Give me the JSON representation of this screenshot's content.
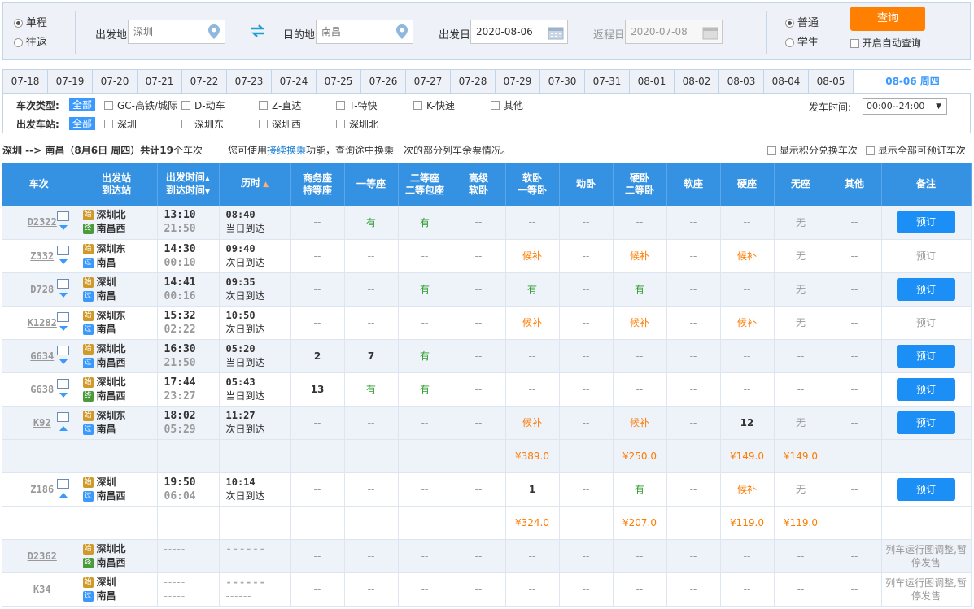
{
  "search": {
    "trip_types": [
      {
        "label": "单程",
        "checked": true
      },
      {
        "label": "往返",
        "checked": false
      }
    ],
    "from_label": "出发地",
    "from_value": "深圳",
    "to_label": "目的地",
    "to_value": "南昌",
    "date_label": "出发日",
    "date_value": "2020-08-06",
    "return_label": "返程日",
    "return_value": "2020-07-08",
    "pass_types": [
      {
        "label": "普通",
        "checked": true
      },
      {
        "label": "学生",
        "checked": false
      }
    ],
    "query_label": "查询",
    "auto_label": "开启自动查询"
  },
  "date_tabs": [
    "07-18",
    "07-19",
    "07-20",
    "07-21",
    "07-22",
    "07-23",
    "07-24",
    "07-25",
    "07-26",
    "07-27",
    "07-28",
    "07-29",
    "07-30",
    "07-31",
    "08-01",
    "08-02",
    "08-03",
    "08-04",
    "08-05"
  ],
  "current_tab": "08-06 周四",
  "filter": {
    "type_title": "车次类型:",
    "all": "全部",
    "types": [
      "GC-高铁/城际",
      "D-动车",
      "Z-直达",
      "T-特快",
      "K-快速",
      "其他"
    ],
    "station_title": "出发车站:",
    "stations": [
      "深圳",
      "深圳东",
      "深圳西",
      "深圳北"
    ],
    "time_title": "发车时间:",
    "time_value": "00:00--24:00"
  },
  "info": {
    "route": "深圳 --> 南昌（8月6日  周四）共计",
    "count": "19",
    "count_suffix": "个车次",
    "tip_prefix": "您可使用",
    "tip_link": "接续换乘",
    "tip_suffix": "功能，查询途中换乘一次的部分列车余票情况。",
    "opt1": "显示积分兑换车次",
    "opt2": "显示全部可预订车次"
  },
  "columns": [
    [
      "车次"
    ],
    [
      "出发站",
      "到达站"
    ],
    [
      "出发时间",
      "到达时间"
    ],
    [
      "历时"
    ],
    [
      "商务座",
      "特等座"
    ],
    [
      "一等座"
    ],
    [
      "二等座",
      "二等包座"
    ],
    [
      "高级",
      "软卧"
    ],
    [
      "软卧",
      "一等卧"
    ],
    [
      "动卧"
    ],
    [
      "硬卧",
      "二等卧"
    ],
    [
      "软座"
    ],
    [
      "硬座"
    ],
    [
      "无座"
    ],
    [
      "其他"
    ],
    [
      "备注"
    ]
  ],
  "rows": [
    {
      "code": "D2322",
      "arrow": "down",
      "from": "深圳北",
      "fromType": "始",
      "to": "南昌西",
      "toType": "终",
      "dep": "13:10",
      "arr": "21:50",
      "dur": "08:40",
      "day": "当日到达",
      "seats": [
        "--",
        "有",
        "有",
        "--",
        "--",
        "--",
        "--",
        "--",
        "--",
        "无",
        "--"
      ],
      "note": "预订",
      "bookable": true,
      "alt": true
    },
    {
      "code": "Z332",
      "arrow": "down",
      "from": "深圳东",
      "fromType": "始",
      "to": "南昌",
      "toType": "过",
      "dep": "14:30",
      "arr": "00:10",
      "dur": "09:40",
      "day": "次日到达",
      "seats": [
        "--",
        "--",
        "--",
        "--",
        "候补",
        "--",
        "候补",
        "--",
        "候补",
        "无",
        "--"
      ],
      "note": "预订",
      "bookable": false,
      "alt": false
    },
    {
      "code": "D728",
      "arrow": "down",
      "from": "深圳",
      "fromType": "始",
      "to": "南昌",
      "toType": "过",
      "dep": "14:41",
      "arr": "00:16",
      "dur": "09:35",
      "day": "次日到达",
      "seats": [
        "--",
        "--",
        "有",
        "--",
        "有",
        "--",
        "有",
        "--",
        "--",
        "无",
        "--"
      ],
      "note": "预订",
      "bookable": true,
      "alt": true
    },
    {
      "code": "K1282",
      "arrow": "down",
      "from": "深圳东",
      "fromType": "始",
      "to": "南昌",
      "toType": "过",
      "dep": "15:32",
      "arr": "02:22",
      "dur": "10:50",
      "day": "次日到达",
      "seats": [
        "--",
        "--",
        "--",
        "--",
        "候补",
        "--",
        "候补",
        "--",
        "候补",
        "无",
        "--"
      ],
      "note": "预订",
      "bookable": false,
      "alt": false
    },
    {
      "code": "G634",
      "arrow": "down",
      "from": "深圳北",
      "fromType": "始",
      "to": "南昌西",
      "toType": "过",
      "dep": "16:30",
      "arr": "21:50",
      "dur": "05:20",
      "day": "当日到达",
      "seats": [
        "2",
        "7",
        "有",
        "--",
        "--",
        "--",
        "--",
        "--",
        "--",
        "--",
        "--"
      ],
      "note": "预订",
      "bookable": true,
      "alt": true
    },
    {
      "code": "G638",
      "arrow": "down",
      "from": "深圳北",
      "fromType": "始",
      "to": "南昌西",
      "toType": "终",
      "dep": "17:44",
      "arr": "23:27",
      "dur": "05:43",
      "day": "当日到达",
      "seats": [
        "13",
        "有",
        "有",
        "--",
        "--",
        "--",
        "--",
        "--",
        "--",
        "--",
        "--"
      ],
      "note": "预订",
      "bookable": true,
      "alt": false
    },
    {
      "code": "K92",
      "arrow": "up",
      "from": "深圳东",
      "fromType": "始",
      "to": "南昌",
      "toType": "过",
      "dep": "18:02",
      "arr": "05:29",
      "dur": "11:27",
      "day": "次日到达",
      "seats": [
        "--",
        "--",
        "--",
        "--",
        "候补",
        "--",
        "候补",
        "--",
        "12",
        "无",
        "--"
      ],
      "note": "预订",
      "bookable": true,
      "alt": true,
      "prices": [
        "",
        "",
        "",
        "",
        "¥389.0",
        "",
        "¥250.0",
        "",
        "¥149.0",
        "¥149.0",
        ""
      ]
    },
    {
      "code": "Z186",
      "arrow": "up",
      "from": "深圳",
      "fromType": "始",
      "to": "南昌西",
      "toType": "过",
      "dep": "19:50",
      "arr": "06:04",
      "dur": "10:14",
      "day": "次日到达",
      "seats": [
        "--",
        "--",
        "--",
        "--",
        "1",
        "--",
        "有",
        "--",
        "候补",
        "无",
        "--"
      ],
      "note": "预订",
      "bookable": true,
      "alt": false,
      "prices": [
        "",
        "",
        "",
        "",
        "¥324.0",
        "",
        "¥207.0",
        "",
        "¥119.0",
        "¥119.0",
        ""
      ]
    },
    {
      "code": "D2362",
      "arrow": "",
      "from": "深圳北",
      "fromType": "始",
      "to": "南昌西",
      "toType": "终",
      "dep": "-----",
      "arr": "-----",
      "dur": "------",
      "day": "------",
      "seats": [
        "--",
        "--",
        "--",
        "--",
        "--",
        "--",
        "--",
        "--",
        "--",
        "--",
        "--"
      ],
      "note": "列车运行图调整,暂停发售",
      "bookable": false,
      "alt": true,
      "stopped": true
    },
    {
      "code": "K34",
      "arrow": "",
      "from": "深圳",
      "fromType": "始",
      "to": "南昌",
      "toType": "过",
      "dep": "-----",
      "arr": "-----",
      "dur": "------",
      "day": "------",
      "seats": [
        "--",
        "--",
        "--",
        "--",
        "--",
        "--",
        "--",
        "--",
        "--",
        "--",
        "--"
      ],
      "note": "列车运行图调整,暂停发售",
      "bookable": false,
      "alt": false,
      "stopped": true
    }
  ]
}
